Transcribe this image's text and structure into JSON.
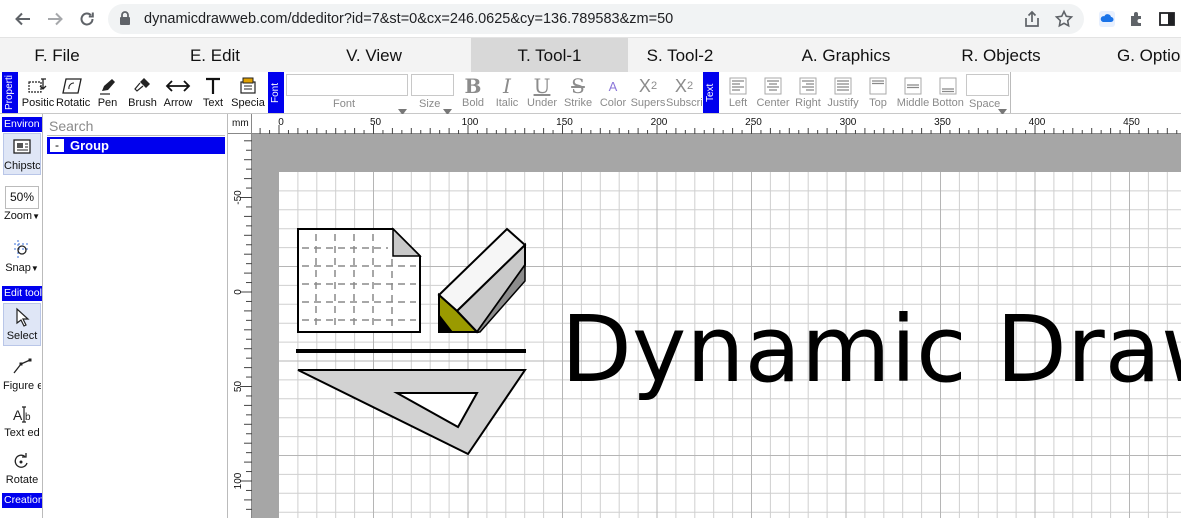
{
  "browser": {
    "url": "dynamicdrawweb.com/ddeditor?id=7&st=0&cx=246.0625&cy=136.789583&zm=50"
  },
  "menu": [
    {
      "label": "F. File"
    },
    {
      "label": "E. Edit"
    },
    {
      "label": "V. View"
    },
    {
      "label": "T. Tool-1"
    },
    {
      "label": "S. Tool-2"
    },
    {
      "label": "A. Graphics"
    },
    {
      "label": "R. Objects"
    },
    {
      "label": "G. Option"
    }
  ],
  "ribbon": {
    "property_tab": "Properti",
    "tools": [
      {
        "label": "Positic"
      },
      {
        "label": "Rotatic"
      },
      {
        "label": "Pen"
      },
      {
        "label": "Brush"
      },
      {
        "label": "Arrow"
      },
      {
        "label": "Text"
      },
      {
        "label": "Specia"
      }
    ],
    "font_tab": "Font",
    "font_label": "Font",
    "size_label": "Size",
    "styles": [
      {
        "glyph": "B",
        "label": "Bold"
      },
      {
        "glyph": "I",
        "label": "Italic"
      },
      {
        "glyph": "U",
        "label": "Under"
      },
      {
        "glyph": "S",
        "label": "Strike"
      },
      {
        "glyph": "A",
        "label": "Color"
      },
      {
        "glyph": "X",
        "sup": "2",
        "label": "Supers"
      },
      {
        "glyph": "X",
        "sub": "2",
        "label": "Subscri"
      }
    ],
    "text_tab": "Text",
    "aligns": [
      {
        "label": "Left"
      },
      {
        "label": "Center"
      },
      {
        "label": "Right"
      },
      {
        "label": "Justify"
      },
      {
        "label": "Top"
      },
      {
        "label": "Middle"
      },
      {
        "label": "Botton"
      }
    ],
    "space_label": "Space"
  },
  "left_panel": {
    "env_header": "Environ",
    "chipstock_label": "Chipstc",
    "zoom_value": "50%",
    "zoom_label": "Zoom",
    "snap_label": "Snap",
    "edit_header": "Edit tool",
    "select_label": "Select",
    "figure_label": "Figure e",
    "textedit_label": "Text ed",
    "rotate_label": "Rotate",
    "creation_header": "Creation"
  },
  "tree": {
    "search_placeholder": "Search",
    "toggle": "-",
    "node_label": "Group"
  },
  "canvas": {
    "unit": "mm",
    "h_ticks": [
      "0",
      "50",
      "100",
      "150",
      "200",
      "250",
      "300",
      "350",
      "400",
      "450"
    ],
    "v_ticks": [
      "-50",
      "0",
      "50",
      "100"
    ],
    "logo_text": "Dynamic Draw"
  },
  "colors": {
    "accent": "#0000ee",
    "pencil_tip": "#9a9a00",
    "canvas_border": "#a6a6a6",
    "grid_line": "#cfcfcf"
  }
}
